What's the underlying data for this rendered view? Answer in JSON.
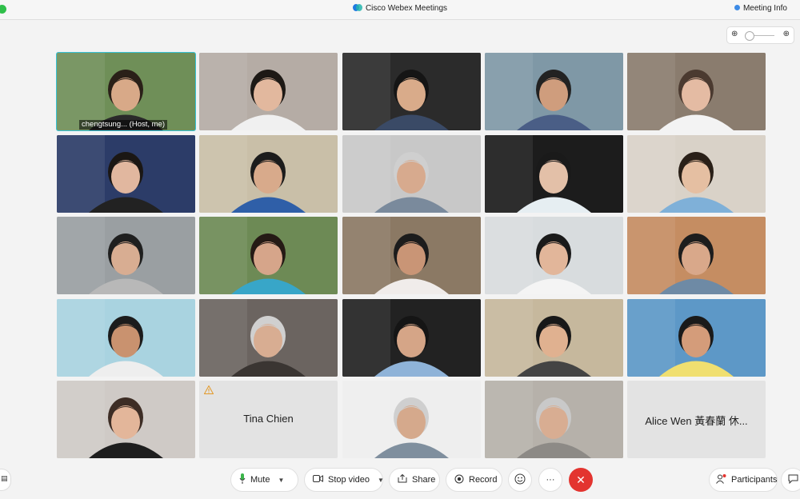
{
  "window": {
    "title": "Cisco Webex Meetings",
    "meeting_info_label": "Meeting Info"
  },
  "zoom": {
    "zoom_out_icon": "zoom-out-icon",
    "zoom_in_icon": "zoom-in-icon",
    "level": 0.1
  },
  "tiles": [
    {
      "name_label": "chengtsung...   (Host, me)",
      "bg": "#6f8f58",
      "skin": "#d8a988",
      "hair": "#2a2018",
      "shirt": "#2a2a2a",
      "host": true
    },
    {
      "bg": "#b5aca5",
      "skin": "#e2b89e",
      "hair": "#1d1915",
      "shirt": "#f0f0f0"
    },
    {
      "bg": "#2b2b2b",
      "skin": "#d9ab8a",
      "hair": "#151515",
      "shirt": "#3a4a66"
    },
    {
      "bg": "#7f98a6",
      "skin": "#cf9d7d",
      "hair": "#222",
      "shirt": "#4a5e86"
    },
    {
      "bg": "#8a7c6e",
      "skin": "#e4bba3",
      "hair": "#4b3a30",
      "shirt": "#f3f3f3"
    },
    {
      "bg": "#2c3c68",
      "skin": "#e1b79f",
      "hair": "#1b1714",
      "shirt": "#222"
    },
    {
      "bg": "#c9bfa8",
      "skin": "#d8aa8b",
      "hair": "#1c1c1c",
      "shirt": "#2f5fa8"
    },
    {
      "bg": "#c8c8c8",
      "skin": "#d7aa8e",
      "hair": "#cfcfcf",
      "shirt": "#7a8a9c"
    },
    {
      "bg": "#1c1c1c",
      "skin": "#e3c0a8",
      "hair": "#1a1a1a",
      "shirt": "#e6eef2"
    },
    {
      "bg": "#d9d2c8",
      "skin": "#e5bfa2",
      "hair": "#2a2018",
      "shirt": "#7fb0d8"
    },
    {
      "bg": "#9a9fa2",
      "skin": "#d8ad92",
      "hair": "#1f1f1f",
      "shirt": "#b8b8b8"
    },
    {
      "bg": "#6d8a55",
      "skin": "#d6a58a",
      "hair": "#251a15",
      "shirt": "#38a6c8"
    },
    {
      "bg": "#8b7964",
      "skin": "#c99576",
      "hair": "#1c1c1c",
      "shirt": "#f0ecea"
    },
    {
      "bg": "#d8dcde",
      "skin": "#e2b69a",
      "hair": "#1a1a1a",
      "shirt": "#f4f4f4"
    },
    {
      "bg": "#c58d62",
      "skin": "#d9a88a",
      "hair": "#1d1d1d",
      "shirt": "#6e8aa5"
    },
    {
      "bg": "#a9d3e0",
      "skin": "#c9926f",
      "hair": "#1c1c1c",
      "shirt": "#eeeeee"
    },
    {
      "bg": "#6b6460",
      "skin": "#d8ad92",
      "hair": "#d0d0d0",
      "shirt": "#3a3532"
    },
    {
      "bg": "#222222",
      "skin": "#d5a587",
      "hair": "#151515",
      "shirt": "#8fb3d8"
    },
    {
      "bg": "#c6b89d",
      "skin": "#e0b190",
      "hair": "#181818",
      "shirt": "#444"
    },
    {
      "bg": "#5d98c7",
      "skin": "#d49c7a",
      "hair": "#1a1a1a",
      "shirt": "#f0df70"
    },
    {
      "bg": "#cfcac6",
      "skin": "#e3b69a",
      "hair": "#3d2d25",
      "shirt": "#1e1e1e"
    },
    {
      "name_text": "Tina Chien",
      "warning": true
    },
    {
      "bg": "#eeeeee",
      "skin": "#d5a98c",
      "hair": "#cfcfcf",
      "shirt": "#7f8f9e"
    },
    {
      "bg": "#b6b1aa",
      "skin": "#d8ad92",
      "hair": "#c9c9c9",
      "shirt": "#8d8a86"
    },
    {
      "name_text": "Alice Wen 黃春蘭 休..."
    }
  ],
  "toolbar": {
    "mute_label": "Mute",
    "stop_video_label": "Stop video",
    "share_label": "Share",
    "record_label": "Record",
    "more_label": "···",
    "participants_label": "Participants"
  },
  "colors": {
    "accent": "#36c2d6",
    "end": "#e3342f",
    "mic": "#3bb54a"
  }
}
